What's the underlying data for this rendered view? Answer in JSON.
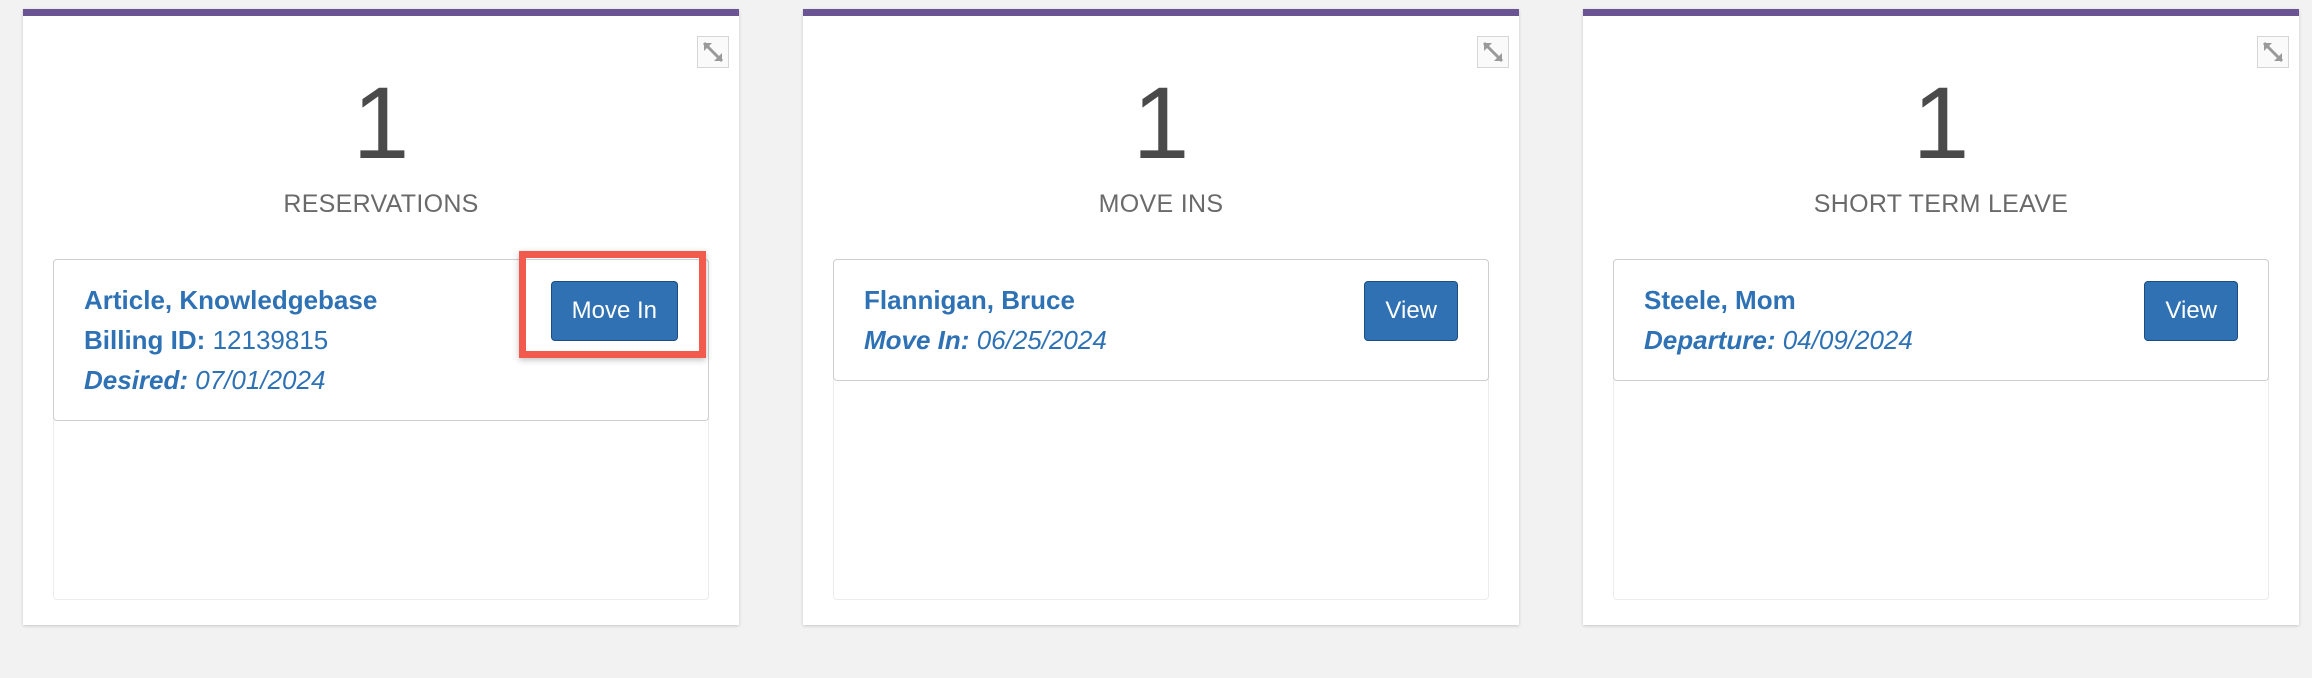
{
  "panels": [
    {
      "count": "1",
      "label": "RESERVATIONS",
      "item": {
        "name": "Article, Knowledgebase",
        "billing_label": "Billing ID:",
        "billing_value": "12139815",
        "date_label": "Desired:",
        "date_value": "07/01/2024",
        "button": "Move In"
      }
    },
    {
      "count": "1",
      "label": "MOVE INS",
      "item": {
        "name": "Flannigan, Bruce",
        "date_label": "Move In:",
        "date_value": "06/25/2024",
        "button": "View"
      }
    },
    {
      "count": "1",
      "label": "SHORT TERM LEAVE",
      "item": {
        "name": "Steele, Mom",
        "date_label": "Departure:",
        "date_value": "04/09/2024",
        "button": "View"
      }
    }
  ],
  "icons": {
    "expand": "expand-icon"
  },
  "colors": {
    "accent_bar": "#6a5592",
    "link_text": "#2e72b5",
    "button_bg": "#2f71b2",
    "highlight": "#f25a4d",
    "page_bg": "#f2f2f2"
  }
}
